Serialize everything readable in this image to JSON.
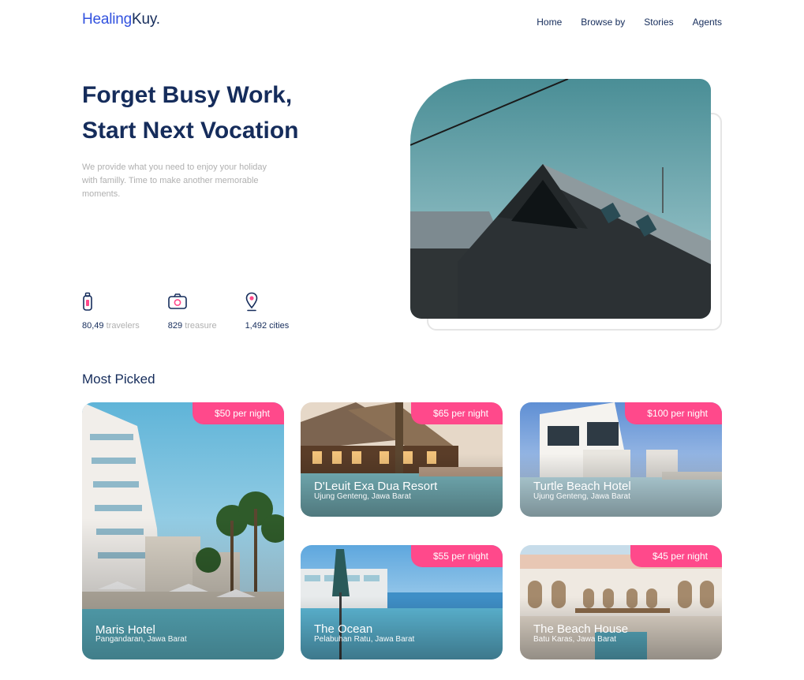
{
  "header": {
    "logo_part1": "Healing",
    "logo_part2": "Kuy.",
    "nav": [
      "Home",
      "Browse by",
      "Stories",
      "Agents"
    ]
  },
  "hero": {
    "title_line1": "Forget Busy Work,",
    "title_line2": "Start Next Vocation",
    "description": "We provide what you need to enjoy your holiday with familly. Time to make another memorable moments.",
    "stats": [
      {
        "icon": "luggage-icon",
        "value": "80,49",
        "unit": "travelers"
      },
      {
        "icon": "camera-icon",
        "value": "829",
        "unit": "treasure"
      },
      {
        "icon": "location-pin-icon",
        "value": "1,492",
        "unit": "cities"
      }
    ]
  },
  "most_picked": {
    "title": "Most Picked",
    "items": [
      {
        "price": "$50 per night",
        "name": "Maris Hotel",
        "location": "Pangandaran, Jawa Barat"
      },
      {
        "price": "$65 per night",
        "name": "D'Leuit Exa Dua Resort",
        "location": "Ujung Genteng, Jawa Barat"
      },
      {
        "price": "$100 per night",
        "name": "Turtle Beach Hotel",
        "location": "Ujung Genteng, Jawa Barat"
      },
      {
        "price": "$55 per night",
        "name": "The Ocean",
        "location": "Pelabuhan Ratu, Jawa Barat"
      },
      {
        "price": "$45 per night",
        "name": "The Beach House",
        "location": "Batu Karas, Jawa Barat"
      }
    ]
  },
  "colors": {
    "primary": "#152c5b",
    "accent": "#3252df",
    "badge": "#ff498b",
    "muted": "#b0b0b0"
  }
}
